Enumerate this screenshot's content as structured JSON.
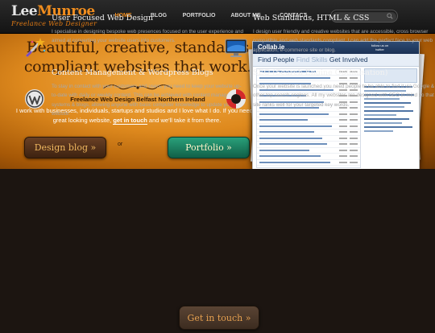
{
  "header": {
    "logo": {
      "first": "Lee",
      "second": "Munroe",
      "tagline": "Freelance Web Designer"
    },
    "nav": [
      {
        "label": "HOME",
        "active": true
      },
      {
        "label": "BLOG",
        "active": false
      },
      {
        "label": "PORTFOLIO",
        "active": false
      },
      {
        "label": "ABOUT ME",
        "active": false
      },
      {
        "label": "CONTACT",
        "active": false
      }
    ],
    "search": {
      "value": "",
      "placeholder": ""
    }
  },
  "hero": {
    "title_line1": "Beautiful, creative, standards",
    "title_line2": "compliant websites that work.",
    "subtitle": "Freelance Web Design Belfast Northern Ireland",
    "text_before": "I work with businesses, individuals, startups and studios and I love what I do. If you need a great looking website, ",
    "text_link": "get in touch",
    "text_after": " and we'll take it from there.",
    "buttons": {
      "blog": "Design blog »",
      "or": "or",
      "portfolio": "Portfolio »"
    },
    "showcase": {
      "site_name": "Collab.ie",
      "heading_start": "Find People ",
      "heading_highlight": "Find Skills",
      "heading_end": " Get Involved",
      "twitter_line1": "follow us on",
      "twitter_line2": "twitter"
    }
  },
  "features": [
    {
      "title": "User Focused Web Design",
      "text": "I specialise in designing bespoke web presences focused on the user experience and aimed at converting your website users into customers.",
      "icon": "magic-wand-icon"
    },
    {
      "title": "Web Standards, HTML & CSS",
      "text": "I design user friendly and creative websites that are accessible, cross browser compatible and web standards compliant. I can add the perfect face to your web application, e-commerce site or blog.",
      "icon": "monitor-icon"
    },
    {
      "title": "Content Management & Wordpress Blogs",
      "text": "To stay in contact with your customers and users, you need to keep your website up-to-date with daily or weekly content. This can be achieved with content management systems & blogs, allowing anyone with basic computer knowledge to update your website.",
      "icon": "wordpress-icon"
    },
    {
      "title": "SEO (Search Engine Optimisation)",
      "text": "Once your website is launched you need people to be able to find it via Google & other top search engines. All my websites are designed with SEO in mind so that your site ranks well for your targeted key words.",
      "icon": "lifebuoy-icon"
    }
  ],
  "cta": {
    "label": "Get in touch »"
  },
  "colors": {
    "accent": "#f08d1e",
    "background": "#1c1511",
    "portfolio_button": "#1f8a66"
  }
}
